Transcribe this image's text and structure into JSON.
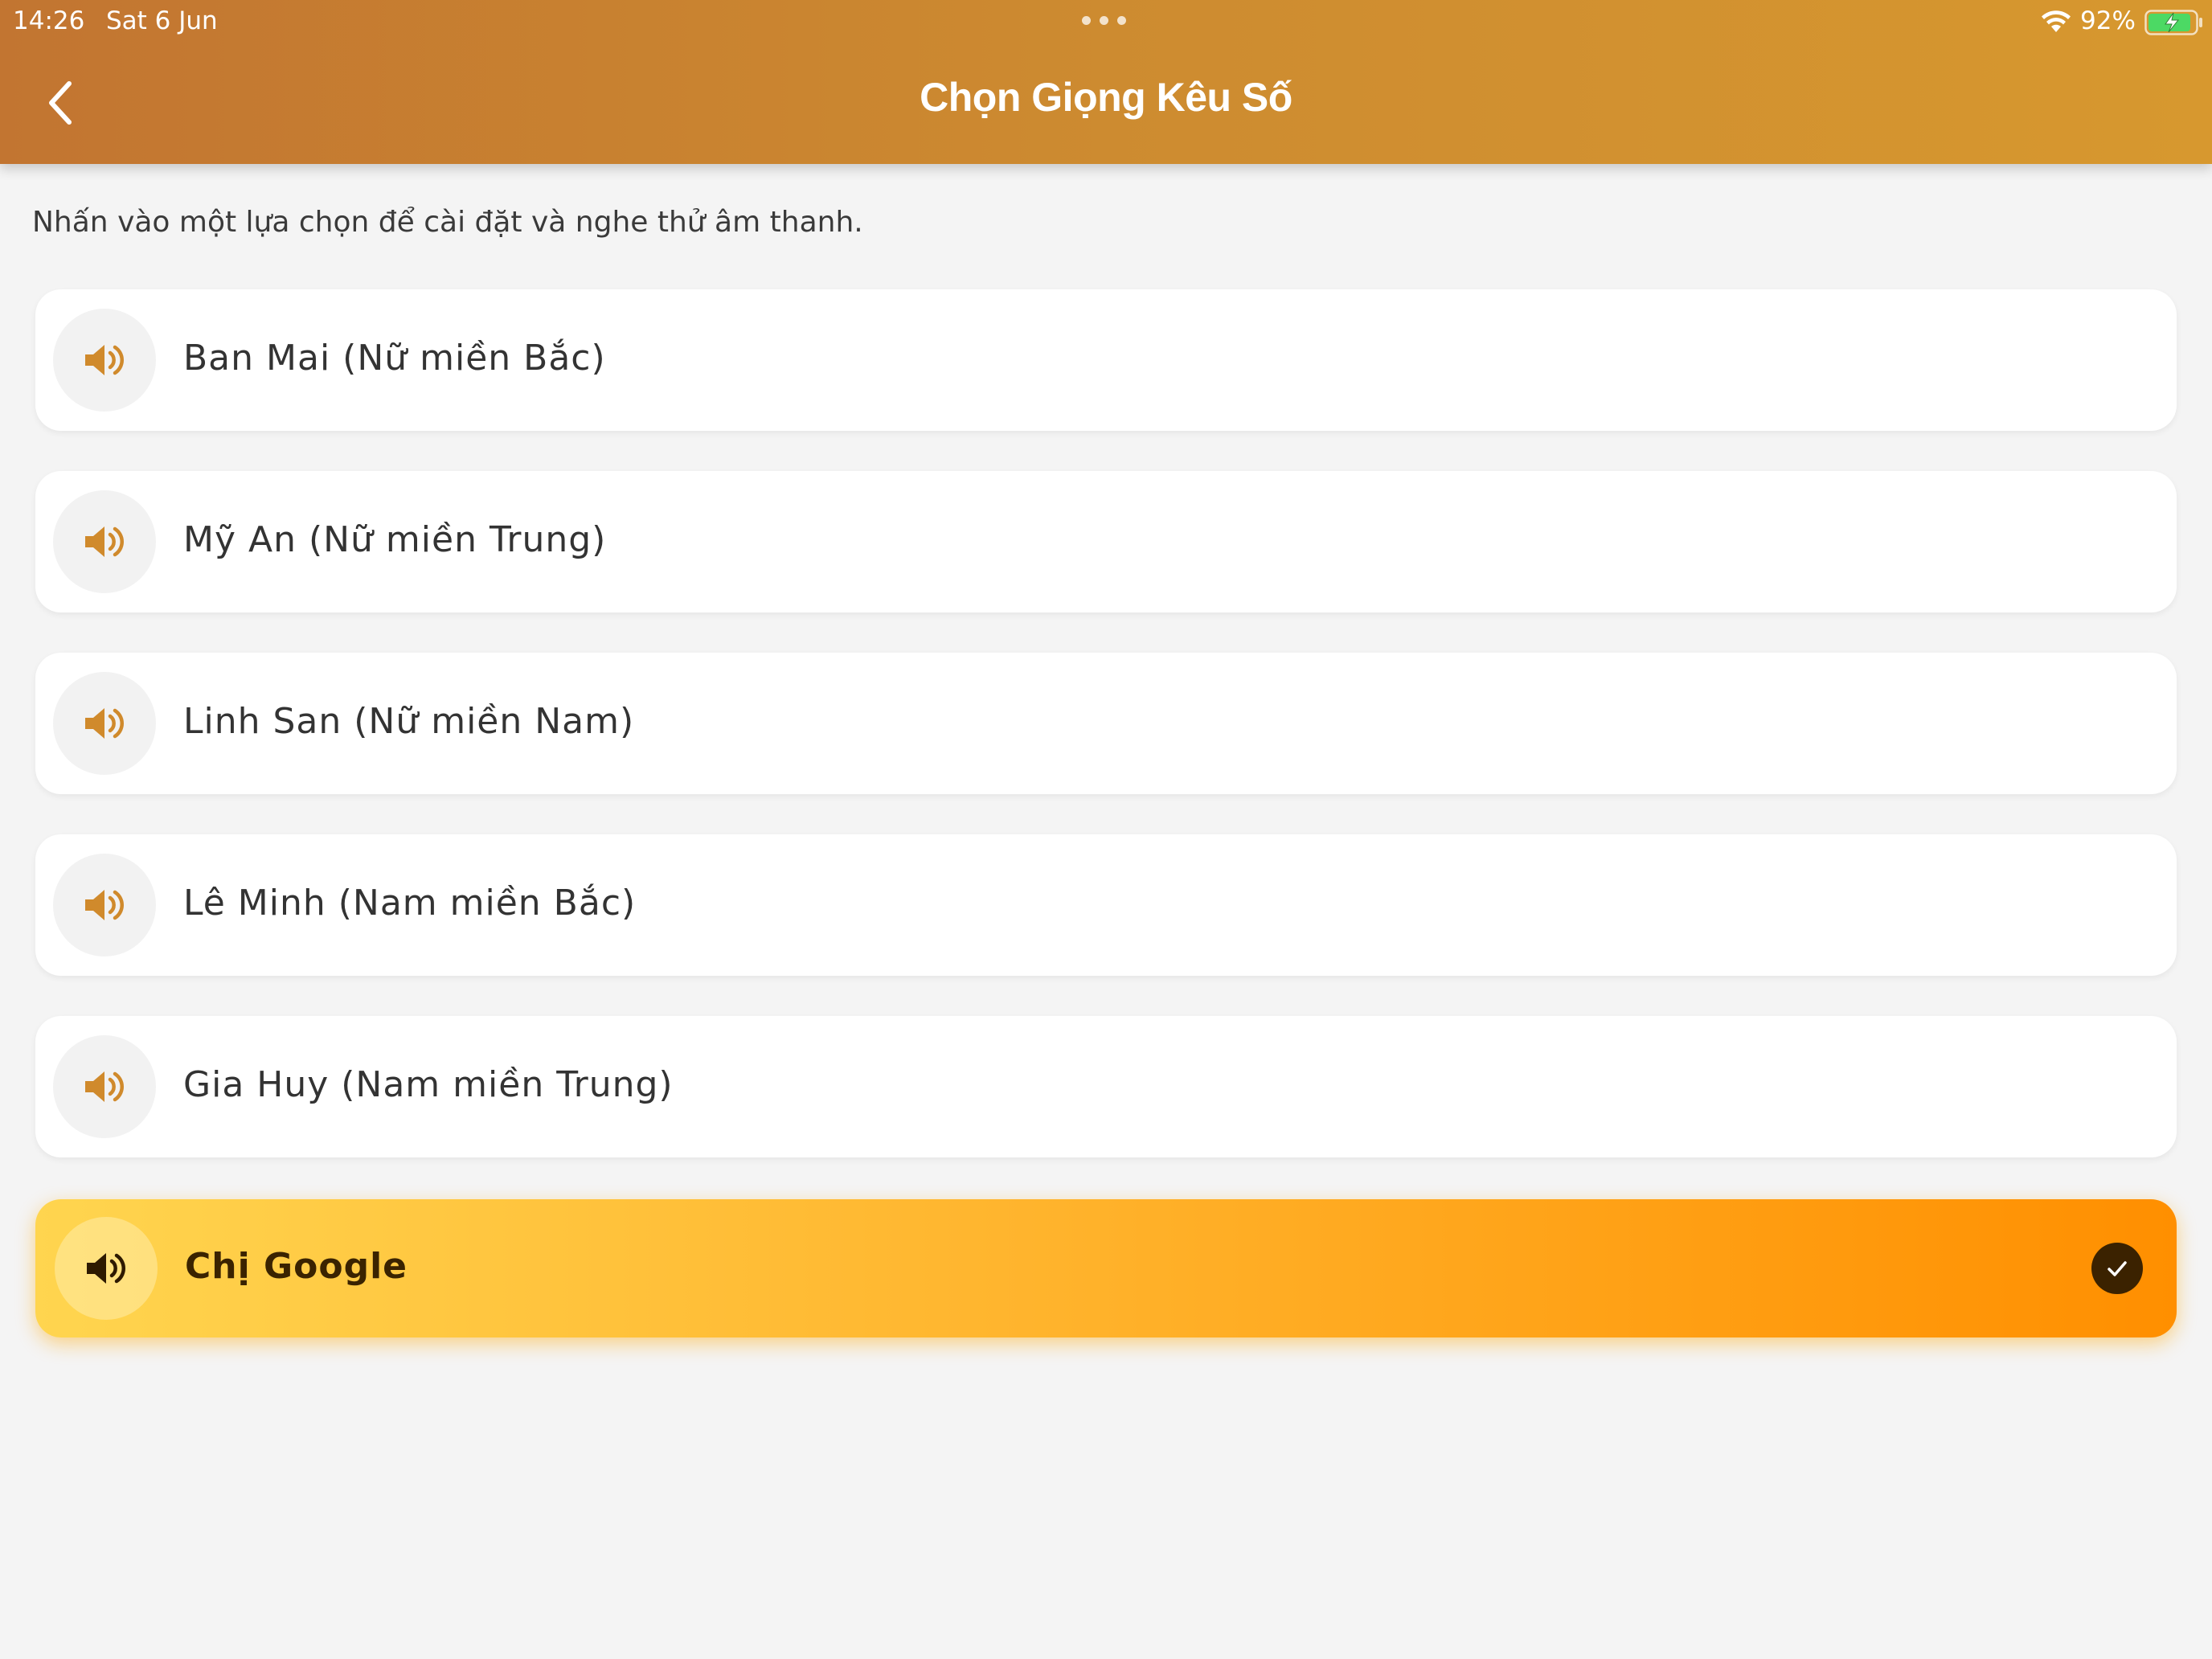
{
  "status_bar": {
    "time": "14:26",
    "date": "Sat 6 Jun",
    "battery_percent": "92%",
    "icons": [
      "wifi-icon",
      "battery-charging-icon",
      "multitask-dots-icon"
    ]
  },
  "header": {
    "title": "Chọn Giọng Kêu Số",
    "back_icon": "chevron-left-icon",
    "gradient_colors": [
      "#c27531",
      "#d7982f"
    ]
  },
  "instruction": "Nhấn vào một lựa chọn để cài đặt và nghe thử âm thanh.",
  "voices": [
    {
      "label": "Ban Mai (Nữ miền Bắc)",
      "icon": "speaker-icon",
      "selected": false
    },
    {
      "label": "Mỹ An (Nữ miền Trung)",
      "icon": "speaker-icon",
      "selected": false
    },
    {
      "label": "Linh San (Nữ miền Nam)",
      "icon": "speaker-icon",
      "selected": false
    },
    {
      "label": "Lê Minh (Nam miền Bắc)",
      "icon": "speaker-icon",
      "selected": false
    },
    {
      "label": "Gia Huy (Nam miền Trung)",
      "icon": "speaker-icon",
      "selected": false
    },
    {
      "label": "Chị Google",
      "icon": "speaker-icon",
      "selected": true,
      "badge_icon": "checkmark-icon"
    }
  ],
  "colors": {
    "accent": "#d08a2c",
    "selected_gradient": [
      "#ffd54f",
      "#ff8f00"
    ],
    "selected_text": "#3a2300"
  }
}
